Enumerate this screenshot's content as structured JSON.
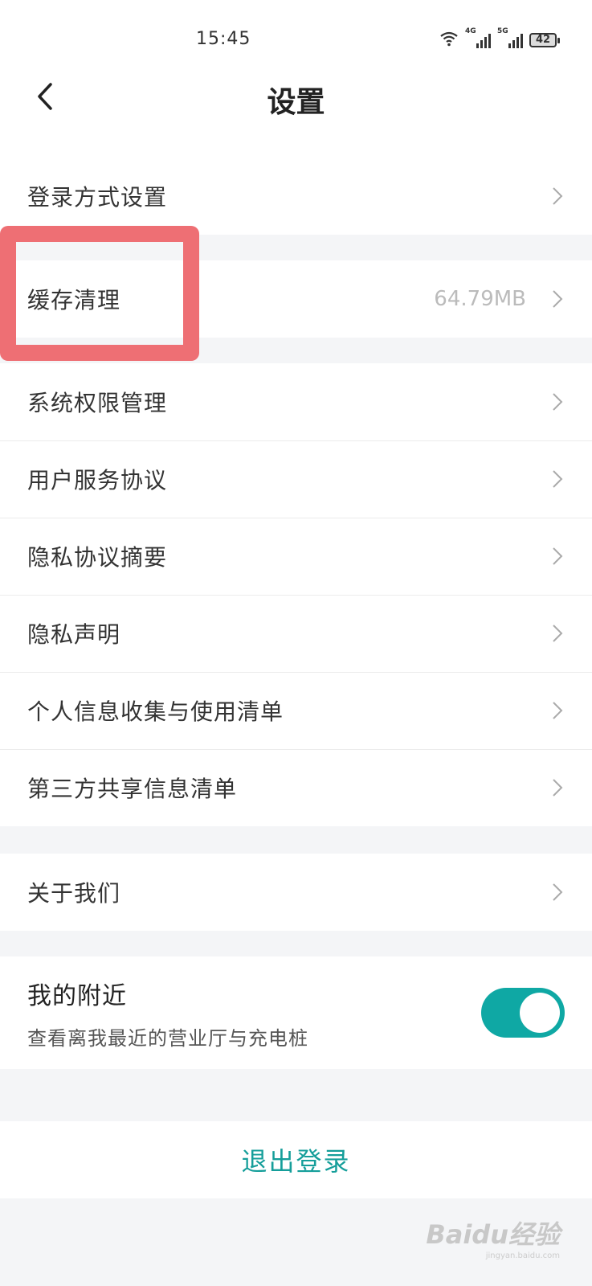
{
  "status_bar": {
    "time": "15:45",
    "signal_1_label": "4G",
    "signal_2_label": "5G",
    "battery": "42",
    "icons": [
      "wifi-icon",
      "signal-icon",
      "signal-icon",
      "battery-icon"
    ]
  },
  "header": {
    "title": "设置",
    "back_icon": "chevron-left-icon"
  },
  "settings": {
    "login": {
      "label": "登录方式设置"
    },
    "cache": {
      "label": "缓存清理",
      "value": "64.79MB"
    },
    "items": [
      {
        "label": "系统权限管理"
      },
      {
        "label": "用户服务协议"
      },
      {
        "label": "隐私协议摘要"
      },
      {
        "label": "隐私声明"
      },
      {
        "label": "个人信息收集与使用清单"
      },
      {
        "label": "第三方共享信息清单"
      }
    ],
    "about": {
      "label": "关于我们"
    },
    "nearby": {
      "title": "我的附近",
      "subtitle": "查看离我最近的营业厅与充电桩",
      "enabled": true
    },
    "logout_label": "退出登录"
  },
  "colors": {
    "accent": "#0fa8a4",
    "logout_text": "#159e9a",
    "highlight_box": "#ee6f74",
    "background": "#f4f5f7"
  },
  "watermark": {
    "brand": "Baidu经验",
    "sub": "jingyan.baidu.com"
  }
}
